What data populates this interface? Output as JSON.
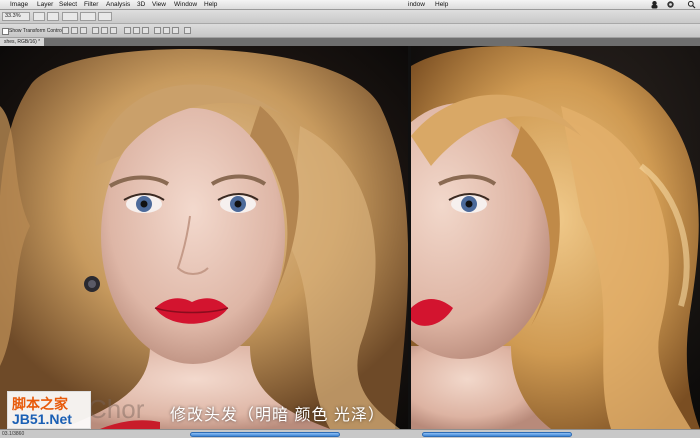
{
  "menubar": {
    "items": [
      "Image",
      "Layer",
      "Select",
      "Filter",
      "Analysis",
      "3D",
      "View",
      "Window",
      "Help"
    ],
    "second_window_label": "indow",
    "second_help_label": "Help"
  },
  "options_bar": {
    "zoom": "33.3%"
  },
  "control_bar": {
    "show_transform_controls": "Show Transform Controls"
  },
  "document": {
    "tab_label": "shes, RGB/16) *"
  },
  "canvas": {
    "caption": "修改头发（明暗 颜色 光泽）",
    "ghost_text": "Chor"
  },
  "watermark": {
    "line1": "脚本之家",
    "line2": "JB51.Net"
  },
  "status": {
    "text": "03.1/3860"
  }
}
